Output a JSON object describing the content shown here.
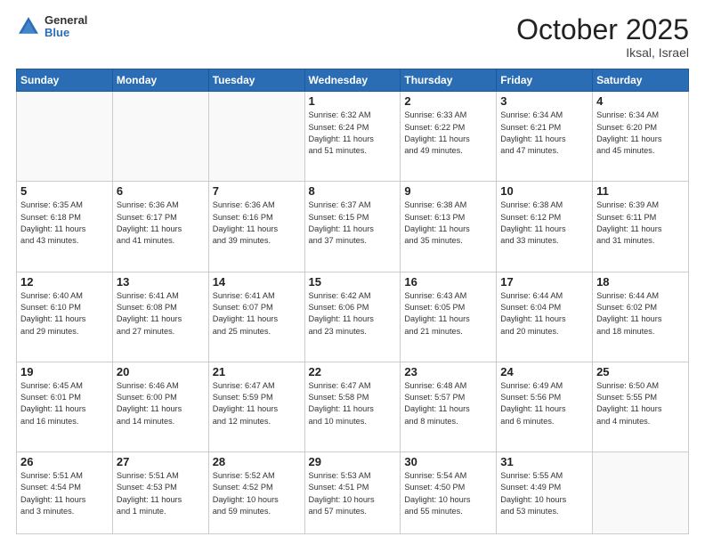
{
  "header": {
    "logo_general": "General",
    "logo_blue": "Blue",
    "month": "October 2025",
    "location": "Iksal, Israel"
  },
  "days_of_week": [
    "Sunday",
    "Monday",
    "Tuesday",
    "Wednesday",
    "Thursday",
    "Friday",
    "Saturday"
  ],
  "weeks": [
    [
      {
        "day": "",
        "info": ""
      },
      {
        "day": "",
        "info": ""
      },
      {
        "day": "",
        "info": ""
      },
      {
        "day": "1",
        "info": "Sunrise: 6:32 AM\nSunset: 6:24 PM\nDaylight: 11 hours\nand 51 minutes."
      },
      {
        "day": "2",
        "info": "Sunrise: 6:33 AM\nSunset: 6:22 PM\nDaylight: 11 hours\nand 49 minutes."
      },
      {
        "day": "3",
        "info": "Sunrise: 6:34 AM\nSunset: 6:21 PM\nDaylight: 11 hours\nand 47 minutes."
      },
      {
        "day": "4",
        "info": "Sunrise: 6:34 AM\nSunset: 6:20 PM\nDaylight: 11 hours\nand 45 minutes."
      }
    ],
    [
      {
        "day": "5",
        "info": "Sunrise: 6:35 AM\nSunset: 6:18 PM\nDaylight: 11 hours\nand 43 minutes."
      },
      {
        "day": "6",
        "info": "Sunrise: 6:36 AM\nSunset: 6:17 PM\nDaylight: 11 hours\nand 41 minutes."
      },
      {
        "day": "7",
        "info": "Sunrise: 6:36 AM\nSunset: 6:16 PM\nDaylight: 11 hours\nand 39 minutes."
      },
      {
        "day": "8",
        "info": "Sunrise: 6:37 AM\nSunset: 6:15 PM\nDaylight: 11 hours\nand 37 minutes."
      },
      {
        "day": "9",
        "info": "Sunrise: 6:38 AM\nSunset: 6:13 PM\nDaylight: 11 hours\nand 35 minutes."
      },
      {
        "day": "10",
        "info": "Sunrise: 6:38 AM\nSunset: 6:12 PM\nDaylight: 11 hours\nand 33 minutes."
      },
      {
        "day": "11",
        "info": "Sunrise: 6:39 AM\nSunset: 6:11 PM\nDaylight: 11 hours\nand 31 minutes."
      }
    ],
    [
      {
        "day": "12",
        "info": "Sunrise: 6:40 AM\nSunset: 6:10 PM\nDaylight: 11 hours\nand 29 minutes."
      },
      {
        "day": "13",
        "info": "Sunrise: 6:41 AM\nSunset: 6:08 PM\nDaylight: 11 hours\nand 27 minutes."
      },
      {
        "day": "14",
        "info": "Sunrise: 6:41 AM\nSunset: 6:07 PM\nDaylight: 11 hours\nand 25 minutes."
      },
      {
        "day": "15",
        "info": "Sunrise: 6:42 AM\nSunset: 6:06 PM\nDaylight: 11 hours\nand 23 minutes."
      },
      {
        "day": "16",
        "info": "Sunrise: 6:43 AM\nSunset: 6:05 PM\nDaylight: 11 hours\nand 21 minutes."
      },
      {
        "day": "17",
        "info": "Sunrise: 6:44 AM\nSunset: 6:04 PM\nDaylight: 11 hours\nand 20 minutes."
      },
      {
        "day": "18",
        "info": "Sunrise: 6:44 AM\nSunset: 6:02 PM\nDaylight: 11 hours\nand 18 minutes."
      }
    ],
    [
      {
        "day": "19",
        "info": "Sunrise: 6:45 AM\nSunset: 6:01 PM\nDaylight: 11 hours\nand 16 minutes."
      },
      {
        "day": "20",
        "info": "Sunrise: 6:46 AM\nSunset: 6:00 PM\nDaylight: 11 hours\nand 14 minutes."
      },
      {
        "day": "21",
        "info": "Sunrise: 6:47 AM\nSunset: 5:59 PM\nDaylight: 11 hours\nand 12 minutes."
      },
      {
        "day": "22",
        "info": "Sunrise: 6:47 AM\nSunset: 5:58 PM\nDaylight: 11 hours\nand 10 minutes."
      },
      {
        "day": "23",
        "info": "Sunrise: 6:48 AM\nSunset: 5:57 PM\nDaylight: 11 hours\nand 8 minutes."
      },
      {
        "day": "24",
        "info": "Sunrise: 6:49 AM\nSunset: 5:56 PM\nDaylight: 11 hours\nand 6 minutes."
      },
      {
        "day": "25",
        "info": "Sunrise: 6:50 AM\nSunset: 5:55 PM\nDaylight: 11 hours\nand 4 minutes."
      }
    ],
    [
      {
        "day": "26",
        "info": "Sunrise: 5:51 AM\nSunset: 4:54 PM\nDaylight: 11 hours\nand 3 minutes."
      },
      {
        "day": "27",
        "info": "Sunrise: 5:51 AM\nSunset: 4:53 PM\nDaylight: 11 hours\nand 1 minute."
      },
      {
        "day": "28",
        "info": "Sunrise: 5:52 AM\nSunset: 4:52 PM\nDaylight: 10 hours\nand 59 minutes."
      },
      {
        "day": "29",
        "info": "Sunrise: 5:53 AM\nSunset: 4:51 PM\nDaylight: 10 hours\nand 57 minutes."
      },
      {
        "day": "30",
        "info": "Sunrise: 5:54 AM\nSunset: 4:50 PM\nDaylight: 10 hours\nand 55 minutes."
      },
      {
        "day": "31",
        "info": "Sunrise: 5:55 AM\nSunset: 4:49 PM\nDaylight: 10 hours\nand 53 minutes."
      },
      {
        "day": "",
        "info": ""
      }
    ]
  ]
}
